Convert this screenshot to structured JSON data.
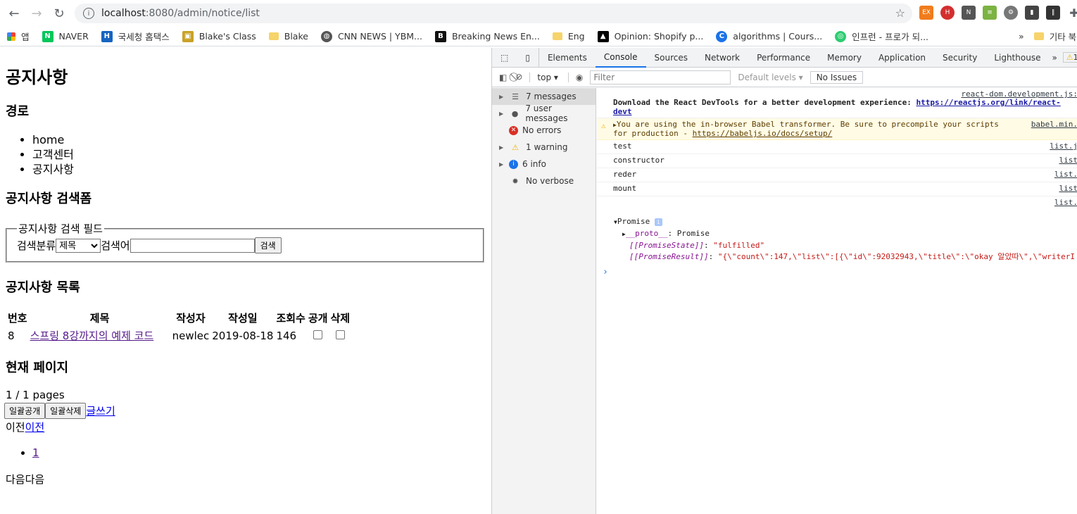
{
  "browser": {
    "url_host": "localhost",
    "url_path": ":8080/admin/notice/list",
    "bookmarks": [
      {
        "label": "앱",
        "color": "#e53935"
      },
      {
        "label": "NAVER",
        "color": "#03c75a"
      },
      {
        "label": "국세청 홈택스",
        "color": "#1565c0"
      },
      {
        "label": "Blake's Class",
        "color": "#c9a227"
      },
      {
        "label": "Blake",
        "folder": true
      },
      {
        "label": "CNN NEWS | YBM...",
        "color": "#555"
      },
      {
        "label": "Breaking News En...",
        "color": "#111"
      },
      {
        "label": "Eng",
        "folder": true
      },
      {
        "label": "Opinion: Shopify p...",
        "color": "#000"
      },
      {
        "label": "algorithms | Cours...",
        "color": "#1a73e8"
      },
      {
        "label": "인프런 - 프로가 되...",
        "color": "#2ecc71"
      }
    ],
    "other_bookmarks": "기타 북마크"
  },
  "page": {
    "title": "공지사항",
    "breadcrumb_heading": "경로",
    "breadcrumb": [
      "home",
      "고객센터",
      "공지사항"
    ],
    "search_heading": "공지사항 검색폼",
    "search_legend": "공지사항 검색 필드",
    "search_category_label": "검색분류",
    "search_category_value": "제목",
    "search_keyword_label": "검색어",
    "search_button": "검색",
    "list_heading": "공지사항 목록",
    "table_headers": [
      "번호",
      "제목",
      "작성자",
      "작성일",
      "조회수",
      "공개",
      "삭제"
    ],
    "rows": [
      {
        "id": "8",
        "title": "스프링 8강까지의 예제 코드",
        "writer": "newlec",
        "date": "2019-08-18",
        "hits": "146"
      }
    ],
    "pager_heading": "현재 페이지",
    "pages_text": "1 / 1 pages",
    "btn_open_all": "일괄공개",
    "btn_delete_all": "일괄삭제",
    "write_link": "글쓰기",
    "prev_text": "이전",
    "prev_link": "이전",
    "page_numbers": [
      "1"
    ],
    "next_text": "다음다음"
  },
  "devtools": {
    "tabs": [
      "Elements",
      "Console",
      "Sources",
      "Network",
      "Performance",
      "Memory",
      "Application",
      "Security",
      "Lighthouse"
    ],
    "active_tab": "Console",
    "warning_count": "1",
    "context": "top",
    "filter_placeholder": "Filter",
    "levels": "Default levels",
    "issues": "No Issues",
    "sidebar": [
      {
        "label": "7 messages",
        "icon": "list-icon",
        "arrow": true
      },
      {
        "label": "7 user messages",
        "icon": "user-icon",
        "arrow": true
      },
      {
        "label": "No errors",
        "icon": "error-icon",
        "arrow": false
      },
      {
        "label": "1 warning",
        "icon": "warning-icon",
        "arrow": true
      },
      {
        "label": "6 info",
        "icon": "info-icon",
        "arrow": true
      },
      {
        "label": "No verbose",
        "icon": "bug-icon",
        "arrow": false
      }
    ],
    "messages": {
      "react_src": "react-dom.development.js:",
      "react_text": "Download the React DevTools for a better development experience: ",
      "react_link": "https://reactjs.org/link/react-devt",
      "babel_text": "You are using the in-browser Babel transformer. Be sure to precompile your scripts for production - ",
      "babel_link": "https://babeljs.io/docs/setup/",
      "babel_src": "babel.min.",
      "logs": [
        {
          "text": "test",
          "src": "list.j"
        },
        {
          "text": "constructor",
          "src": "list"
        },
        {
          "text": "reder",
          "src": "list."
        },
        {
          "text": "mount",
          "src": "list"
        },
        {
          "text": "",
          "src": "list."
        }
      ],
      "promise_label": "Promise",
      "proto_key": "__proto__",
      "proto_val": "Promise",
      "state_key": "[[PromiseState]]",
      "state_val": "\"fulfilled\"",
      "result_key": "[[PromiseResult]]",
      "result_val": "\"{\\\"count\\\":147,\\\"list\\\":[{\\\"id\\\":92032943,\\\"title\\\":\\\"okay 알았따\\\",\\\"writerI"
    }
  }
}
